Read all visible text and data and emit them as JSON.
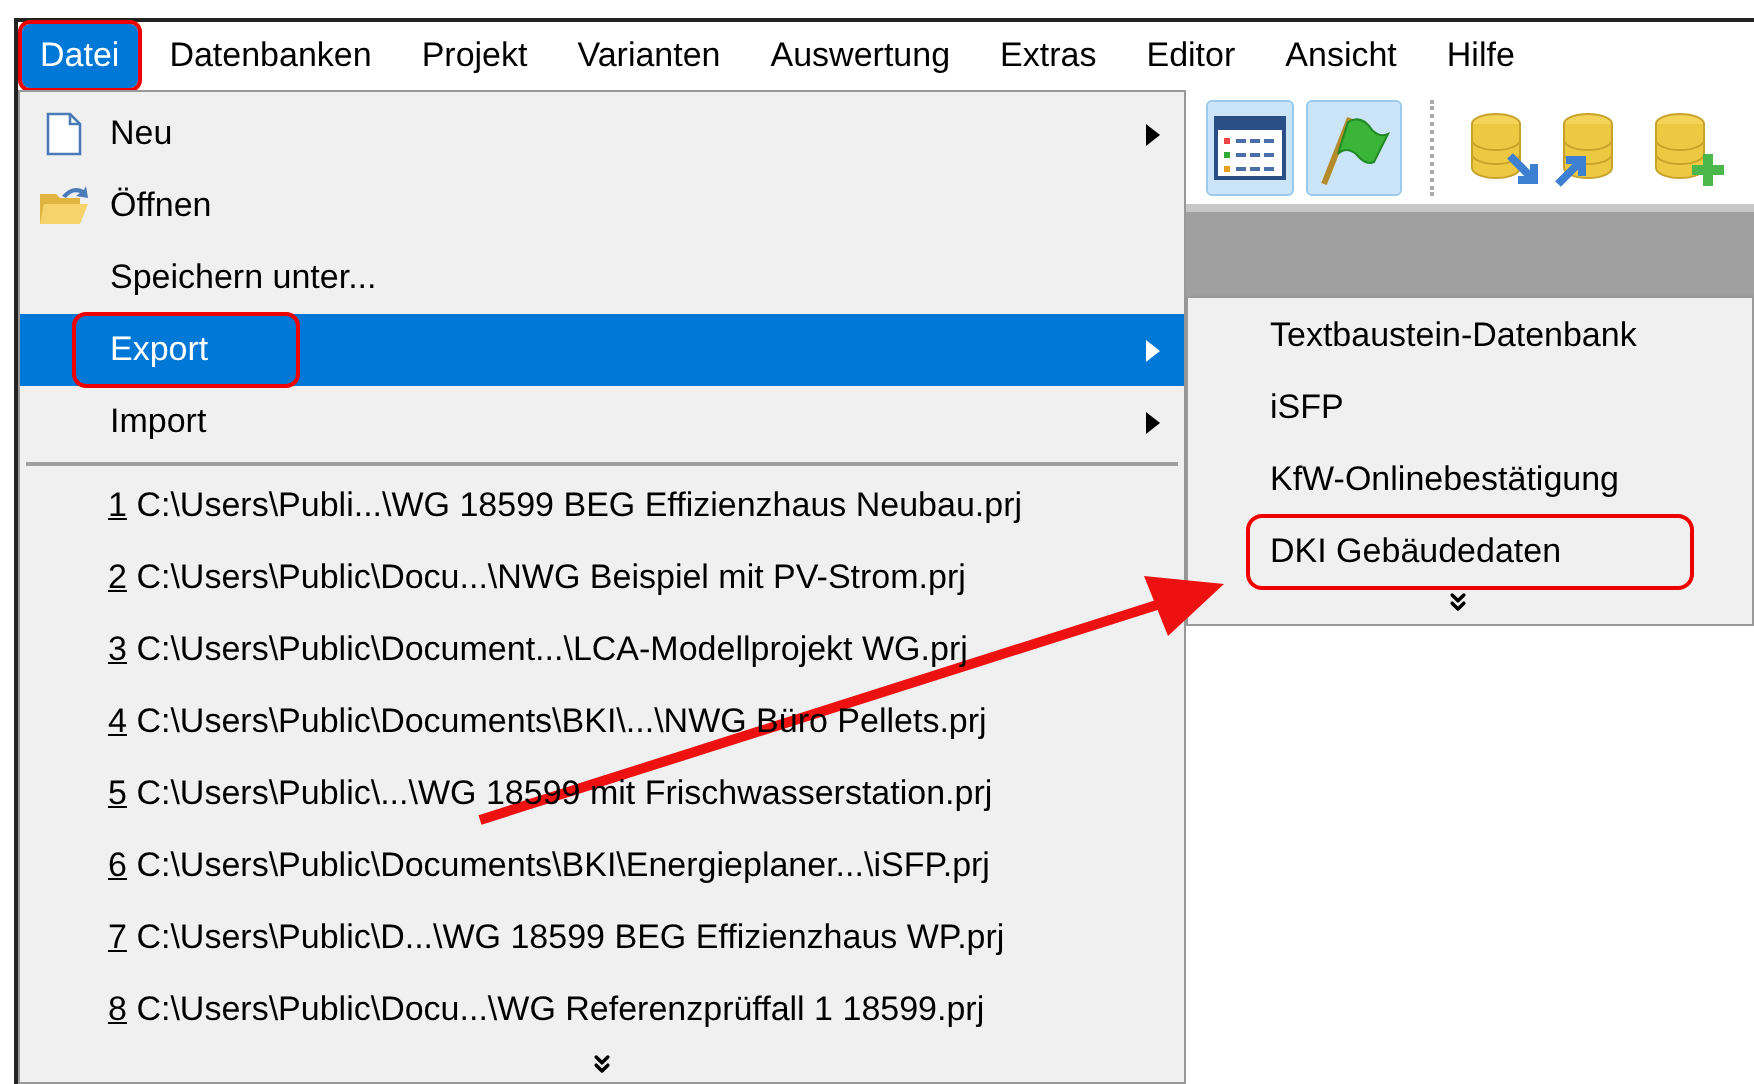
{
  "menubar": [
    {
      "label": "Datei",
      "selected": true,
      "annotated": true
    },
    {
      "label": "Datenbanken",
      "selected": false,
      "annotated": false
    },
    {
      "label": "Projekt",
      "selected": false,
      "annotated": false
    },
    {
      "label": "Varianten",
      "selected": false,
      "annotated": false
    },
    {
      "label": "Auswertung",
      "selected": false,
      "annotated": false
    },
    {
      "label": "Extras",
      "selected": false,
      "annotated": false
    },
    {
      "label": "Editor",
      "selected": false,
      "annotated": false
    },
    {
      "label": "Ansicht",
      "selected": false,
      "annotated": false
    },
    {
      "label": "Hilfe",
      "selected": false,
      "annotated": false
    }
  ],
  "file_menu": {
    "items": [
      {
        "label": "Neu",
        "has_submenu": true,
        "selected": false,
        "annotated": false
      },
      {
        "label": "Öffnen",
        "has_submenu": false,
        "selected": false,
        "annotated": false
      },
      {
        "label": "Speichern unter...",
        "has_submenu": false,
        "selected": false,
        "annotated": false
      },
      {
        "label": "Export",
        "has_submenu": true,
        "selected": true,
        "annotated": true
      },
      {
        "label": "Import",
        "has_submenu": true,
        "selected": false,
        "annotated": false
      }
    ],
    "recent_files": [
      {
        "number": "1",
        "path": "C:\\Users\\Publi...\\WG 18599 BEG Effizienzhaus Neubau.prj"
      },
      {
        "number": "2",
        "path": "C:\\Users\\Public\\Docu...\\NWG Beispiel mit PV-Strom.prj"
      },
      {
        "number": "3",
        "path": "C:\\Users\\Public\\Document...\\LCA-Modellprojekt WG.prj"
      },
      {
        "number": "4",
        "path": "C:\\Users\\Public\\Documents\\BKI\\...\\NWG Büro Pellets.prj"
      },
      {
        "number": "5",
        "path": "C:\\Users\\Public\\...\\WG 18599 mit Frischwasserstation.prj"
      },
      {
        "number": "6",
        "path": "C:\\Users\\Public\\Documents\\BKI\\Energieplaner...\\iSFP.prj"
      },
      {
        "number": "7",
        "path": "C:\\Users\\Public\\D...\\WG 18599 BEG Effizienzhaus WP.prj"
      },
      {
        "number": "8",
        "path": "C:\\Users\\Public\\Docu...\\WG Referenzprüffall 1 18599.prj"
      }
    ]
  },
  "export_submenu": {
    "items": [
      {
        "label": "Textbaustein-Datenbank",
        "annotated": false
      },
      {
        "label": "iSFP",
        "annotated": false
      },
      {
        "label": "KfW-Onlinebestätigung",
        "annotated": false
      },
      {
        "label": "DKI Gebäudedaten",
        "annotated": true
      }
    ]
  }
}
